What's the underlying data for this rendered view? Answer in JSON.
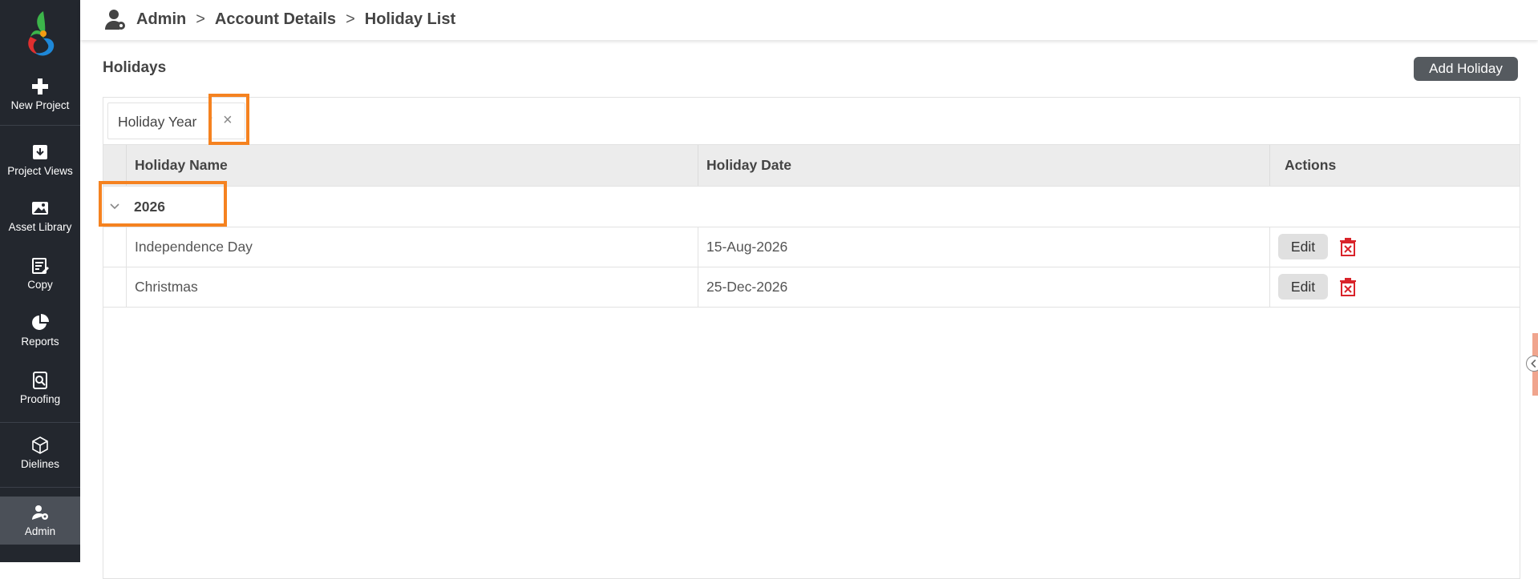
{
  "sidebar": {
    "items": [
      {
        "label": "New Project",
        "icon": "plus-icon"
      },
      {
        "label": "Project Views",
        "icon": "inbox-icon"
      },
      {
        "label": "Asset Library",
        "icon": "image-icon"
      },
      {
        "label": "Copy",
        "icon": "edit-document-icon"
      },
      {
        "label": "Reports",
        "icon": "pie-chart-icon"
      },
      {
        "label": "Proofing",
        "icon": "search-document-icon"
      },
      {
        "label": "Dielines",
        "icon": "cube-icon"
      },
      {
        "label": "Admin",
        "icon": "admin-user-icon",
        "active": true
      }
    ]
  },
  "breadcrumb": {
    "items": [
      "Admin",
      "Account Details",
      "Holiday List"
    ],
    "separator": ">"
  },
  "page": {
    "title": "Holidays",
    "add_button": "Add Holiday"
  },
  "grid": {
    "group_chip": {
      "label": "Holiday Year",
      "sort_indicator": "↑",
      "remove_symbol": "×"
    },
    "columns": [
      "Holiday Name",
      "Holiday Date",
      "Actions"
    ],
    "group": {
      "value": "2026"
    },
    "rows": [
      {
        "name": "Independence Day",
        "date": "15-Aug-2026",
        "edit_label": "Edit"
      },
      {
        "name": "Christmas",
        "date": "25-Dec-2026",
        "edit_label": "Edit"
      }
    ]
  },
  "colors": {
    "sidebar_bg": "#23272e",
    "highlight": "#f58220",
    "delete": "#d9232a",
    "primary_button": "#555a5f"
  }
}
